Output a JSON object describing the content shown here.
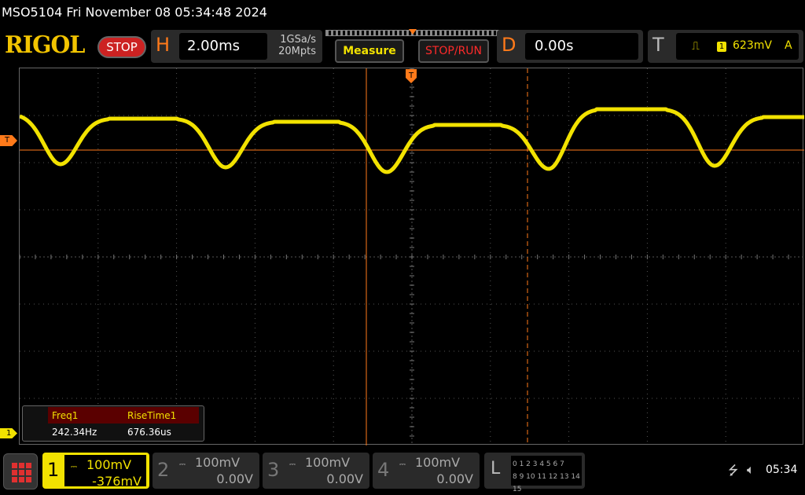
{
  "title": "MSO5104  Fri November 08 05:34:48 2024",
  "brand": "RIGOL",
  "run_state": "STOP",
  "horizontal": {
    "letter": "H",
    "timebase": "2.00ms",
    "sample_rate": "1GSa/s",
    "memory_depth": "20Mpts"
  },
  "buttons": {
    "measure": "Measure",
    "stop_run": "STOP/RUN"
  },
  "delay": {
    "letter": "D",
    "value": "0.00s"
  },
  "trigger": {
    "letter": "T",
    "edge_icon": "rising-edge-icon",
    "source": "1",
    "level": "623mV",
    "mode": "A",
    "marker": "T"
  },
  "channel1_marker": "1",
  "measurements": [
    {
      "name": "Freq1",
      "value": "242.34Hz"
    },
    {
      "name": "RiseTime1",
      "value": "676.36us"
    }
  ],
  "channels": [
    {
      "num": "1",
      "scale": "100mV",
      "offset": "-376mV",
      "active": true
    },
    {
      "num": "2",
      "scale": "100mV",
      "offset": "0.00V",
      "active": false
    },
    {
      "num": "3",
      "scale": "100mV",
      "offset": "0.00V",
      "active": false
    },
    {
      "num": "4",
      "scale": "100mV",
      "offset": "0.00V",
      "active": false
    }
  ],
  "logic": {
    "letter": "L",
    "row1": "0 1 2 3   4 5 6 7",
    "row2": "8 9 10 11  12 13 14 15"
  },
  "status": {
    "time": "05:34",
    "usb_icon": "usb-icon",
    "speaker_icon": "speaker-muted-icon"
  },
  "colors": {
    "ch1": "#f2e200",
    "trigger": "#ff7a1a",
    "stop": "#cc2222"
  }
}
